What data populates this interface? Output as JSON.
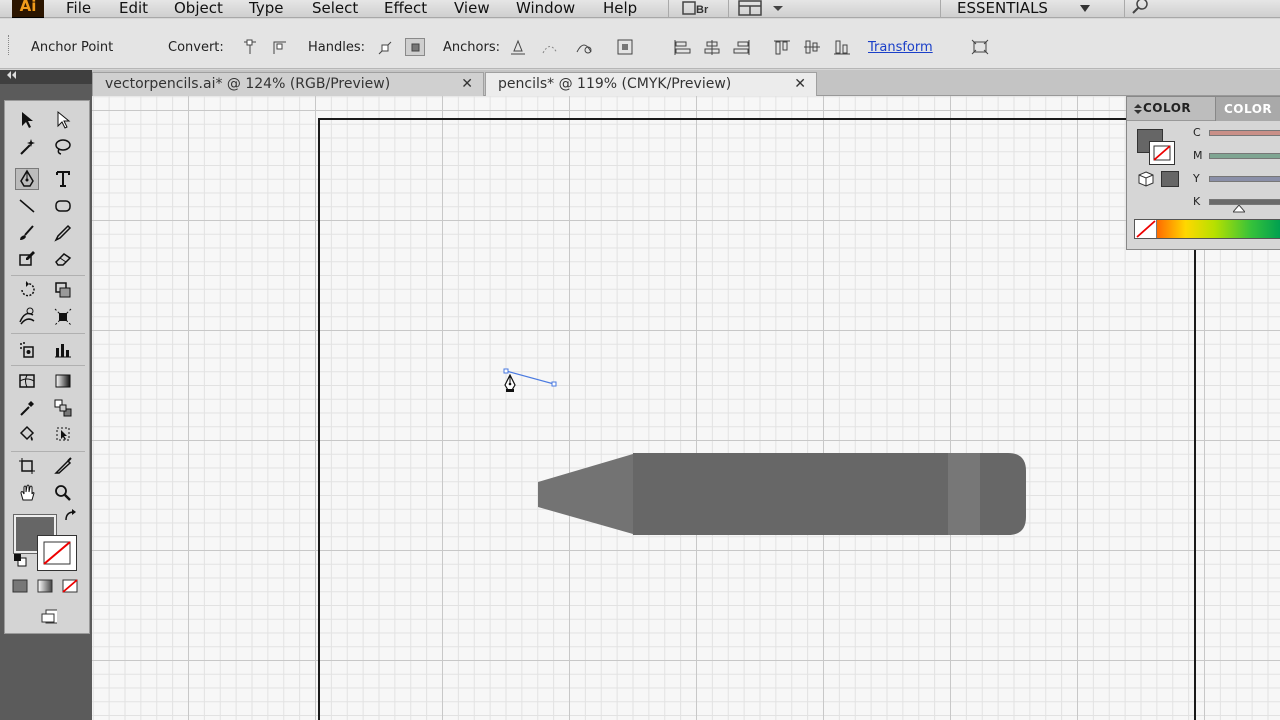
{
  "app": {
    "logo_text": "Ai",
    "workspace": "ESSENTIALS",
    "br_label": "Br"
  },
  "menu": {
    "items": [
      "File",
      "Edit",
      "Object",
      "Type",
      "Select",
      "Effect",
      "View",
      "Window",
      "Help"
    ]
  },
  "control_bar": {
    "tool_name": "Anchor Point",
    "convert_label": "Convert:",
    "handles_label": "Handles:",
    "anchors_label": "Anchors:",
    "transform_link": "Transform"
  },
  "tabs": [
    {
      "label": "vectorpencils.ai* @ 124% (RGB/Preview)",
      "close": "✕",
      "active": false
    },
    {
      "label": "pencils* @ 119% (CMYK/Preview)",
      "close": "✕",
      "active": true
    }
  ],
  "color_panel": {
    "tab1": "COLOR",
    "tab2": "COLOR",
    "sliders": [
      {
        "label": "C",
        "color": "#c98f87"
      },
      {
        "label": "M",
        "color": "#7fa592"
      },
      {
        "label": "Y",
        "color": "#8a8fa8"
      },
      {
        "label": "K",
        "color": "#6a6a6a"
      }
    ]
  },
  "colors": {
    "fill": "#666666",
    "pencil_body": "#676767",
    "pencil_tip": "#737373",
    "pencil_band": "#777777",
    "path_stroke": "#4a7ae0"
  }
}
